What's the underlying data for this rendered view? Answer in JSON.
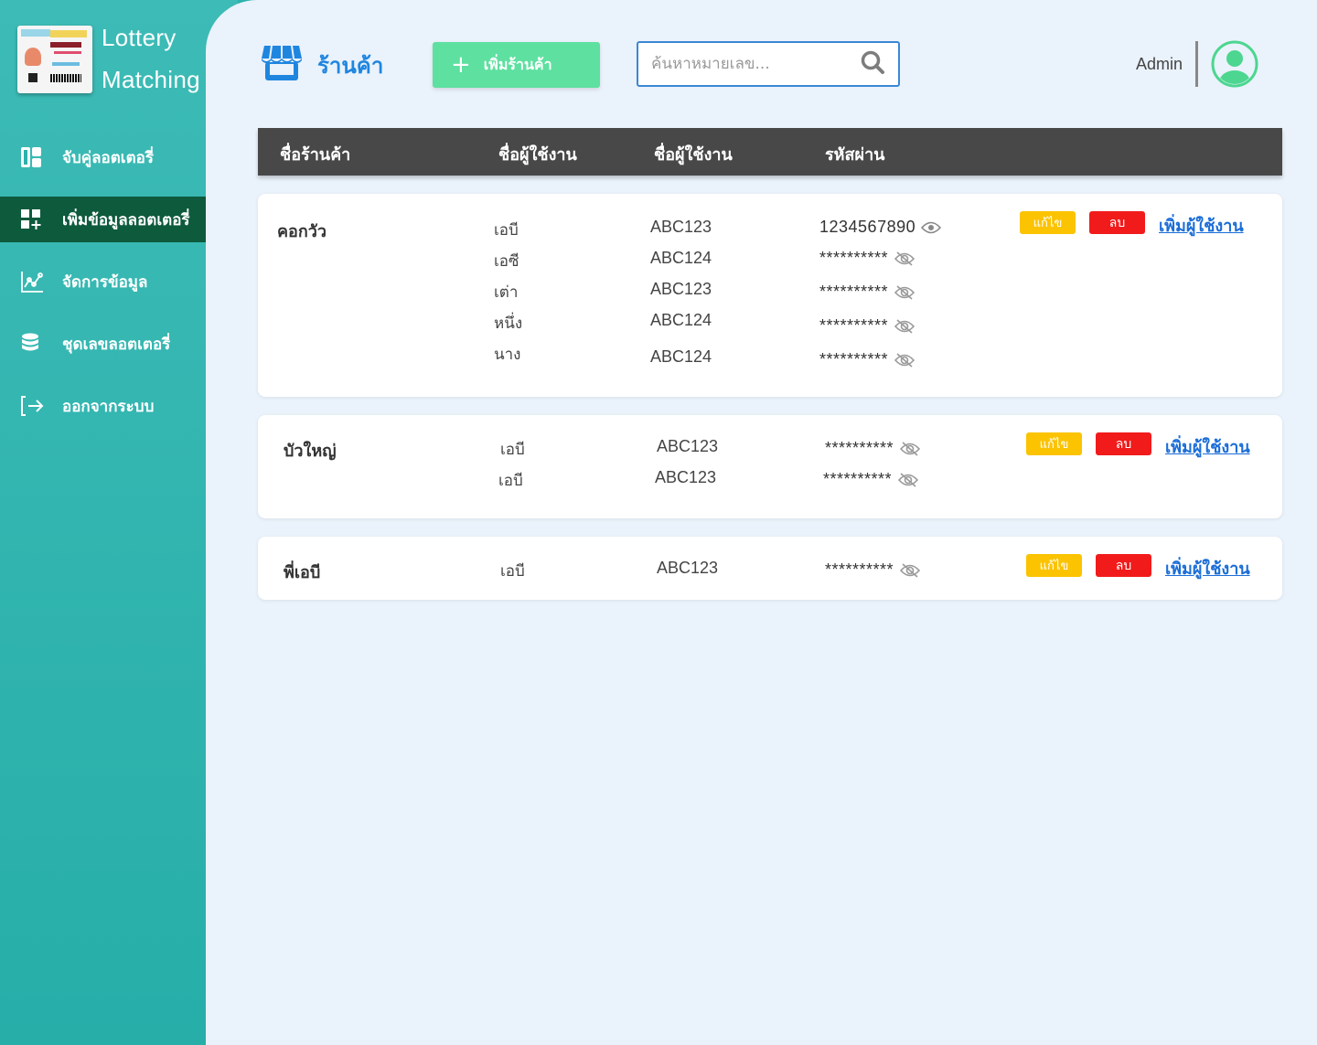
{
  "app": {
    "title_line1": "Lottery",
    "title_line2": "Matching"
  },
  "sidebar": {
    "items": [
      {
        "label": "จับคู่ลอตเตอรี่",
        "icon": "dashboard-icon",
        "active": false
      },
      {
        "label": "เพิ่มข้อมูลลอตเตอรี่",
        "icon": "add-grid-icon",
        "active": true
      },
      {
        "label": "จัดการข้อมูล",
        "icon": "chart-icon",
        "active": false
      },
      {
        "label": "ชุดเลขลอตเตอรี่",
        "icon": "database-icon",
        "active": false
      },
      {
        "label": "ออกจากระบบ",
        "icon": "logout-icon",
        "active": false
      }
    ]
  },
  "header": {
    "title": "ร้านค้า",
    "add_shop_label": "เพิ่มร้านค้า",
    "search_placeholder": "ค้นหาหมายเลข...",
    "user_name": "Admin"
  },
  "table": {
    "columns": [
      "ชื่อร้านค้า",
      "ชื่อผู้ใช้งาน",
      "ชื่อผู้ใช้งาน",
      "รหัสผ่าน"
    ],
    "edit_label": "แก้ไข",
    "delete_label": "ลบ",
    "add_user_label": "เพิ่มผู้ใช้งาน"
  },
  "shops": [
    {
      "name": "คอกวัว",
      "users": [
        {
          "display_name": "เอบี",
          "username": "ABC123",
          "password": "1234567890",
          "visible": true
        },
        {
          "display_name": "เอซี",
          "username": "ABC124",
          "password": "**********",
          "visible": false
        },
        {
          "display_name": "เต่า",
          "username": "ABC123",
          "password": "**********",
          "visible": false
        },
        {
          "display_name": "หนึ่ง",
          "username": "ABC124",
          "password": "**********",
          "visible": false
        },
        {
          "display_name": "นาง",
          "username": "ABC124",
          "password": "**********",
          "visible": false
        }
      ]
    },
    {
      "name": "บัวใหญ่",
      "users": [
        {
          "display_name": "เอบี",
          "username": "ABC123",
          "password": "**********",
          "visible": false
        },
        {
          "display_name": "เอบี",
          "username": "ABC123",
          "password": "**********",
          "visible": false
        }
      ]
    },
    {
      "name": "พี่เอบี",
      "users": [
        {
          "display_name": "เอบี",
          "username": "ABC123",
          "password": "**********",
          "visible": false
        }
      ]
    }
  ],
  "colors": {
    "sidebar_bg": "#2cb2ad",
    "sidebar_active": "#0e5a3d",
    "main_bg": "#eaf2fb",
    "accent_blue": "#1f86e0",
    "add_button": "#5ee0a0",
    "edit_button": "#fbc300",
    "delete_button": "#f11b1b",
    "avatar": "#4cd68f"
  }
}
